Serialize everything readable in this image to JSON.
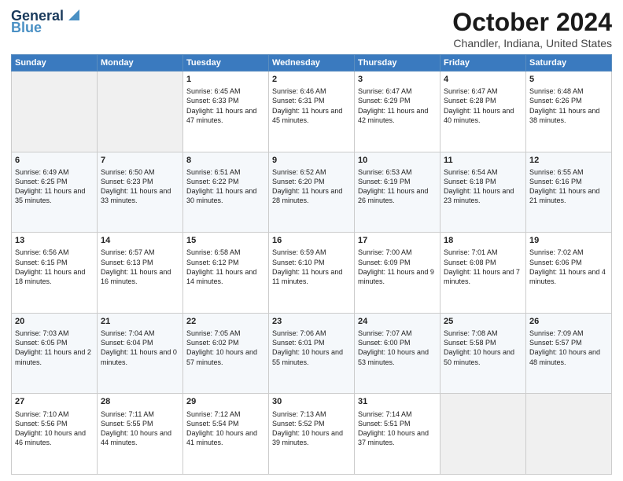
{
  "header": {
    "logo_line1": "General",
    "logo_line2": "Blue",
    "title": "October 2024",
    "subtitle": "Chandler, Indiana, United States"
  },
  "days_of_week": [
    "Sunday",
    "Monday",
    "Tuesday",
    "Wednesday",
    "Thursday",
    "Friday",
    "Saturday"
  ],
  "weeks": [
    [
      {
        "day": "",
        "info": ""
      },
      {
        "day": "",
        "info": ""
      },
      {
        "day": "1",
        "info": "Sunrise: 6:45 AM\nSunset: 6:33 PM\nDaylight: 11 hours and 47 minutes."
      },
      {
        "day": "2",
        "info": "Sunrise: 6:46 AM\nSunset: 6:31 PM\nDaylight: 11 hours and 45 minutes."
      },
      {
        "day": "3",
        "info": "Sunrise: 6:47 AM\nSunset: 6:29 PM\nDaylight: 11 hours and 42 minutes."
      },
      {
        "day": "4",
        "info": "Sunrise: 6:47 AM\nSunset: 6:28 PM\nDaylight: 11 hours and 40 minutes."
      },
      {
        "day": "5",
        "info": "Sunrise: 6:48 AM\nSunset: 6:26 PM\nDaylight: 11 hours and 38 minutes."
      }
    ],
    [
      {
        "day": "6",
        "info": "Sunrise: 6:49 AM\nSunset: 6:25 PM\nDaylight: 11 hours and 35 minutes."
      },
      {
        "day": "7",
        "info": "Sunrise: 6:50 AM\nSunset: 6:23 PM\nDaylight: 11 hours and 33 minutes."
      },
      {
        "day": "8",
        "info": "Sunrise: 6:51 AM\nSunset: 6:22 PM\nDaylight: 11 hours and 30 minutes."
      },
      {
        "day": "9",
        "info": "Sunrise: 6:52 AM\nSunset: 6:20 PM\nDaylight: 11 hours and 28 minutes."
      },
      {
        "day": "10",
        "info": "Sunrise: 6:53 AM\nSunset: 6:19 PM\nDaylight: 11 hours and 26 minutes."
      },
      {
        "day": "11",
        "info": "Sunrise: 6:54 AM\nSunset: 6:18 PM\nDaylight: 11 hours and 23 minutes."
      },
      {
        "day": "12",
        "info": "Sunrise: 6:55 AM\nSunset: 6:16 PM\nDaylight: 11 hours and 21 minutes."
      }
    ],
    [
      {
        "day": "13",
        "info": "Sunrise: 6:56 AM\nSunset: 6:15 PM\nDaylight: 11 hours and 18 minutes."
      },
      {
        "day": "14",
        "info": "Sunrise: 6:57 AM\nSunset: 6:13 PM\nDaylight: 11 hours and 16 minutes."
      },
      {
        "day": "15",
        "info": "Sunrise: 6:58 AM\nSunset: 6:12 PM\nDaylight: 11 hours and 14 minutes."
      },
      {
        "day": "16",
        "info": "Sunrise: 6:59 AM\nSunset: 6:10 PM\nDaylight: 11 hours and 11 minutes."
      },
      {
        "day": "17",
        "info": "Sunrise: 7:00 AM\nSunset: 6:09 PM\nDaylight: 11 hours and 9 minutes."
      },
      {
        "day": "18",
        "info": "Sunrise: 7:01 AM\nSunset: 6:08 PM\nDaylight: 11 hours and 7 minutes."
      },
      {
        "day": "19",
        "info": "Sunrise: 7:02 AM\nSunset: 6:06 PM\nDaylight: 11 hours and 4 minutes."
      }
    ],
    [
      {
        "day": "20",
        "info": "Sunrise: 7:03 AM\nSunset: 6:05 PM\nDaylight: 11 hours and 2 minutes."
      },
      {
        "day": "21",
        "info": "Sunrise: 7:04 AM\nSunset: 6:04 PM\nDaylight: 11 hours and 0 minutes."
      },
      {
        "day": "22",
        "info": "Sunrise: 7:05 AM\nSunset: 6:02 PM\nDaylight: 10 hours and 57 minutes."
      },
      {
        "day": "23",
        "info": "Sunrise: 7:06 AM\nSunset: 6:01 PM\nDaylight: 10 hours and 55 minutes."
      },
      {
        "day": "24",
        "info": "Sunrise: 7:07 AM\nSunset: 6:00 PM\nDaylight: 10 hours and 53 minutes."
      },
      {
        "day": "25",
        "info": "Sunrise: 7:08 AM\nSunset: 5:58 PM\nDaylight: 10 hours and 50 minutes."
      },
      {
        "day": "26",
        "info": "Sunrise: 7:09 AM\nSunset: 5:57 PM\nDaylight: 10 hours and 48 minutes."
      }
    ],
    [
      {
        "day": "27",
        "info": "Sunrise: 7:10 AM\nSunset: 5:56 PM\nDaylight: 10 hours and 46 minutes."
      },
      {
        "day": "28",
        "info": "Sunrise: 7:11 AM\nSunset: 5:55 PM\nDaylight: 10 hours and 44 minutes."
      },
      {
        "day": "29",
        "info": "Sunrise: 7:12 AM\nSunset: 5:54 PM\nDaylight: 10 hours and 41 minutes."
      },
      {
        "day": "30",
        "info": "Sunrise: 7:13 AM\nSunset: 5:52 PM\nDaylight: 10 hours and 39 minutes."
      },
      {
        "day": "31",
        "info": "Sunrise: 7:14 AM\nSunset: 5:51 PM\nDaylight: 10 hours and 37 minutes."
      },
      {
        "day": "",
        "info": ""
      },
      {
        "day": "",
        "info": ""
      }
    ]
  ]
}
